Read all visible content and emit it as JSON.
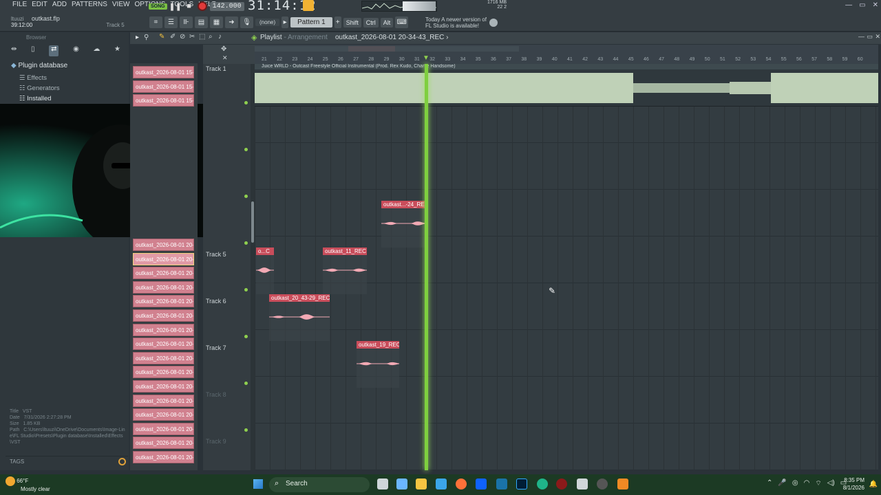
{
  "menu": {
    "items": [
      "FILE",
      "EDIT",
      "ADD",
      "PATTERNS",
      "VIEW",
      "OPTIONS",
      "TOOLS",
      "HELP"
    ]
  },
  "file": {
    "user": "ltuuzi",
    "project": "outkast.flp",
    "position": "39:12:00",
    "track": "Track 5"
  },
  "transport": {
    "song_label": "SONG",
    "tempo": "142.000",
    "time": "31:14:12",
    "cpu_mem": "1716 MB",
    "cpu_voices": "22",
    "cpu_num": "2"
  },
  "toolbar": {
    "snap": "(none)",
    "pattern": "Pattern 1",
    "shift": "Shift",
    "ctrl": "Ctrl",
    "alt": "Alt"
  },
  "update": {
    "line1": "Today A newer version of",
    "line2": "FL Studio is available!"
  },
  "browser": {
    "header": "Browser",
    "root": "Plugin database",
    "items": [
      "Effects",
      "Generators",
      "Installed"
    ],
    "info": {
      "title_label": "Title",
      "title": "VST",
      "date_label": "Date",
      "date": "7/31/2026 2:27:28 PM",
      "size_label": "Size",
      "size": "1.85 KB",
      "path_label": "Path",
      "path": "C:\\Users\\ltuuzi\\OneDrive\\Documents\\Image-Line\\FL Studio\\Presets\\Plugin database\\Installed\\Effects\\VST"
    },
    "tags": "TAGS"
  },
  "channels": [
    "outkast_2026-08-01 15-...",
    "outkast_2026-08-01 15-...",
    "outkast_2026-08-01 15-...",
    "outkast_2026-08-01 20-...",
    "outkast_2026-08-01 20-...",
    "outkast_2026-08-01 20-...",
    "outkast_2026-08-01 20-...",
    "outkast_2026-08-01 20-...",
    "outkast_2026-08-01 20-...",
    "outkast_2026-08-01 20-...",
    "outkast_2026-08-01 20-...",
    "outkast_2026-08-01 20-...",
    "outkast_2026-08-01 20-...",
    "outkast_2026-08-01 20-...",
    "outkast_2026-08-01 20-...",
    "outkast_2026-08-01 20-...",
    "outkast_2026-08-01 20-...",
    "outkast_2026-08-01 20-...",
    "outkast_2026-08-01 20-..."
  ],
  "playlist": {
    "title": "Playlist",
    "subtitle": "- Arrangement",
    "name": "outkast_2026-08-01 20-34-43_REC",
    "ruler": [
      "21",
      "22",
      "23",
      "24",
      "25",
      "26",
      "27",
      "28",
      "29",
      "30",
      "31",
      "32",
      "33",
      "34",
      "35",
      "36",
      "37",
      "38",
      "39",
      "40",
      "41",
      "42",
      "43",
      "44",
      "45",
      "46",
      "47",
      "48",
      "49",
      "50",
      "51",
      "52",
      "53",
      "54",
      "55",
      "56",
      "57",
      "58",
      "59",
      "60"
    ],
    "tracks": [
      {
        "name": "Track 1"
      },
      {
        "name": "Track 5"
      },
      {
        "name": "Track 6"
      },
      {
        "name": "Track 7"
      },
      {
        "name": "Track 8"
      },
      {
        "name": "Track 9"
      }
    ],
    "audio_title": "Juice WRLD - Outcast Freestyle Official Instrumental (Prod. Rex Kudo, Charlie Handsome)",
    "clips": [
      {
        "label": "outkast...-24_REC"
      },
      {
        "label": "o...C"
      },
      {
        "label": "outkast_11_REC"
      },
      {
        "label": "outkast_20_43-29_REC"
      },
      {
        "label": "outkast_19_REC"
      }
    ]
  },
  "taskbar": {
    "temp": "66°F",
    "weather": "Mostly clear",
    "search": "Search",
    "time": "8:35 PM",
    "date": "8/1/2026"
  }
}
